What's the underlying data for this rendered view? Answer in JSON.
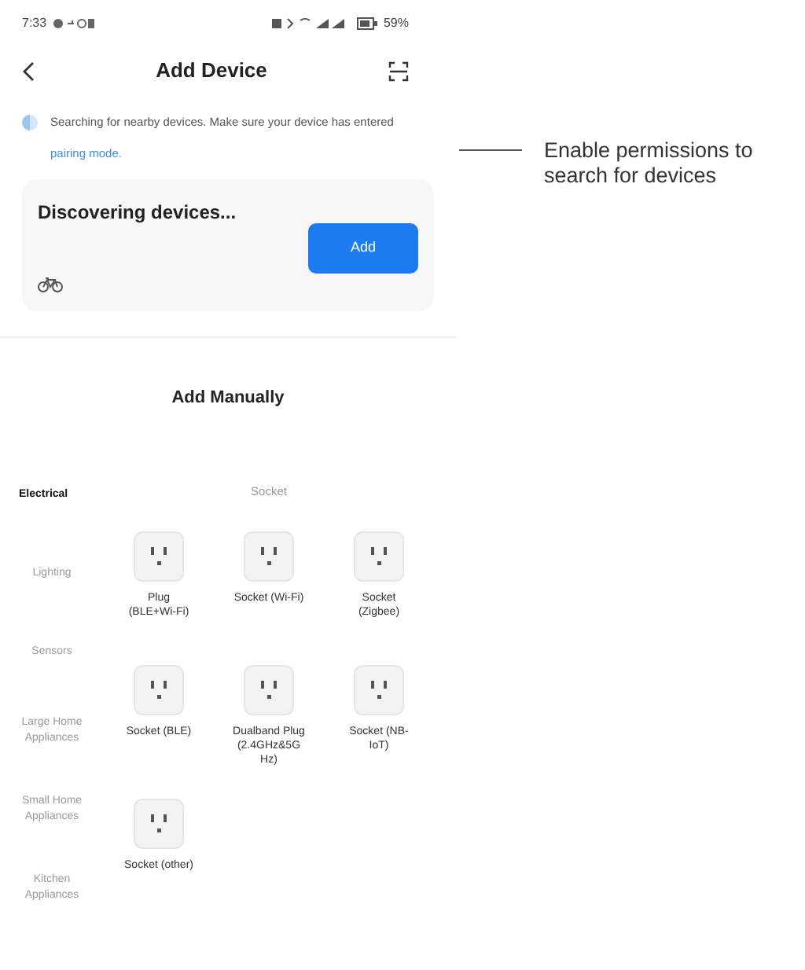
{
  "status_bar": {
    "time": "7:33",
    "battery": "59%"
  },
  "header": {
    "title": "Add Device"
  },
  "notice": {
    "text": "Searching for nearby devices. Make sure your device has entered",
    "link": "pairing mode."
  },
  "discovery": {
    "title": "Discovering devices...",
    "button": "Add"
  },
  "section_title": "Add Manually",
  "categories": [
    {
      "label": "Electrical",
      "selected": true
    },
    {
      "label": "Lighting",
      "selected": false
    },
    {
      "label": "Sensors",
      "selected": false
    },
    {
      "label": "Large Home Appliances",
      "selected": false
    },
    {
      "label": "Small Home Appliances",
      "selected": false
    },
    {
      "label": "Kitchen Appliances",
      "selected": false
    }
  ],
  "group_title": "Socket",
  "devices": [
    {
      "label": "Plug (BLE+Wi-Fi)"
    },
    {
      "label": "Socket (Wi-Fi)"
    },
    {
      "label": "Socket (Zigbee)"
    },
    {
      "label": "Socket (BLE)"
    },
    {
      "label": "Dualband Plug (2.4GHz&5G Hz)"
    },
    {
      "label": "Socket (NB-IoT)"
    },
    {
      "label": "Socket (other)"
    }
  ],
  "annotation": "Enable permissions to search for devices"
}
